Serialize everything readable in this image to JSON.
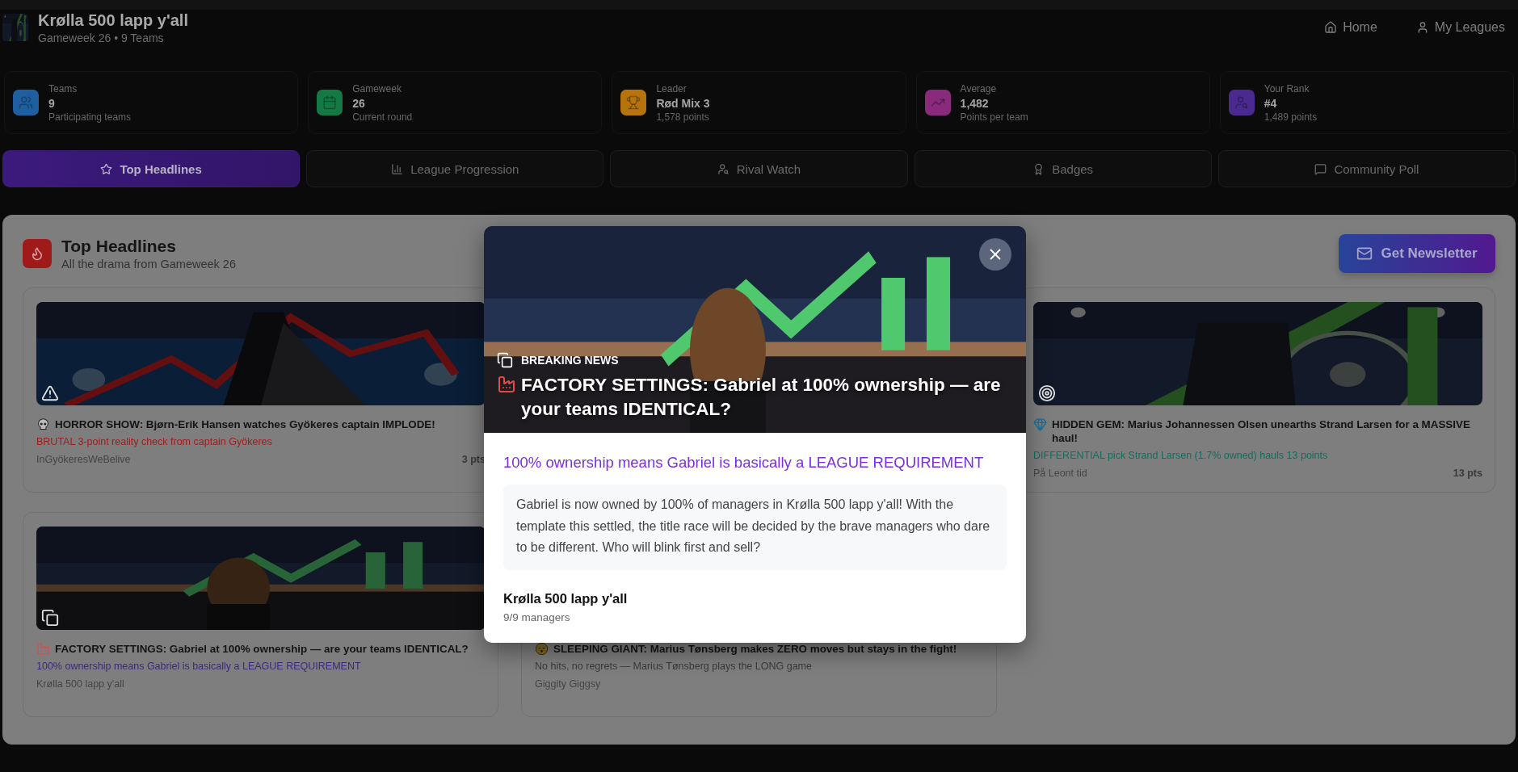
{
  "league": {
    "name": "Krølla 500 lapp y'all",
    "subtitle": "Gameweek 26 • 9 Teams"
  },
  "nav": [
    {
      "label": "Home",
      "kind": "home"
    },
    {
      "label": "My Leagues",
      "kind": "user"
    }
  ],
  "stats": [
    {
      "label": "Teams",
      "value": "9",
      "note": "Participating teams",
      "color": "#1f5fa0",
      "kind": "teams"
    },
    {
      "label": "Gameweek",
      "value": "26",
      "note": "Current round",
      "color": "#137a45",
      "kind": "calendar"
    },
    {
      "label": "Leader",
      "value": "Rød Mix 3",
      "note": "1,578 points",
      "color": "#b8740c",
      "kind": "trophy"
    },
    {
      "label": "Average",
      "value": "1,482",
      "note": "Points per team",
      "color": "#8a2a7c",
      "kind": "chart"
    },
    {
      "label": "Your Rank",
      "value": "#4",
      "note": "1,489 points",
      "color": "#4a2a8e",
      "kind": "rank"
    }
  ],
  "tabs": [
    {
      "label": "Top Headlines",
      "kind": "star",
      "selected": true
    },
    {
      "label": "League Progression",
      "kind": "bars",
      "selected": false
    },
    {
      "label": "Rival Watch",
      "kind": "rival",
      "selected": false
    },
    {
      "label": "Badges",
      "kind": "badge",
      "selected": false
    },
    {
      "label": "Community Poll",
      "kind": "poll",
      "selected": false
    }
  ],
  "section": {
    "title": "Top Headlines",
    "subtitle": "All the drama from Gameweek 26",
    "button": "Get Newsletter"
  },
  "cards": [
    {
      "kind": "horror",
      "title": "HORROR SHOW: Bjørn-Erik Hansen watches Gyökeres captain IMPLODE!",
      "tagline": "BRUTAL 3-point reality check from captain Gyökeres",
      "color": "#a11d1d",
      "author": "InGyökeresWeBelive",
      "points": "3 pts"
    },
    {
      "kind": "gem",
      "title": "HIDDEN GEM: Marius Johannessen Olsen unearths Strand Larsen for a MASSIVE haul!",
      "tagline": "DIFFERENTIAL pick Strand Larsen (1.7% owned) hauls 13 points",
      "color": "#0f6e60",
      "author": "På Leont tid",
      "points": "13 pts"
    },
    {
      "kind": "factory",
      "title": "FACTORY SETTINGS: Gabriel at 100% ownership — are your teams IDENTICAL?",
      "tagline": "100% ownership means Gabriel is basically a LEAGUE REQUIREMENT",
      "color": "#3d2a78",
      "author": "Krølla 500 lapp y'all"
    },
    {
      "kind": "sleeping",
      "title": "SLEEPING GIANT: Marius Tønsberg makes ZERO moves but stays in the fight!",
      "tagline": "No hits, no regrets — Marius Tønsberg plays the LONG game",
      "color": "#3a3a3a",
      "author": "Giggity Giggsy"
    }
  ],
  "modal": {
    "kind": "factory",
    "label": "BREAKING NEWS",
    "title": "FACTORY SETTINGS: Gabriel at 100% ownership — are your teams IDENTICAL?",
    "tagline": "100% ownership means Gabriel is basically a LEAGUE REQUIREMENT",
    "body": "Gabriel is now owned by 100% of managers in Krølla 500 lapp y'all! With the template this settled, the title race will be decided by the brave managers who dare to be different. Who will blink first and sell?",
    "league": "Krølla 500 lapp y'all",
    "managers": "9/9 managers"
  }
}
